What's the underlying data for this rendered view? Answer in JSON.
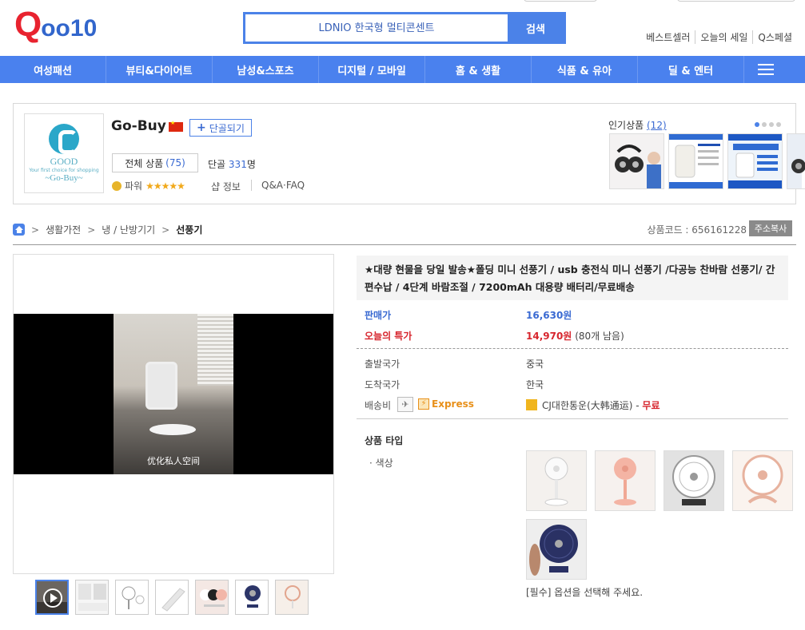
{
  "header": {
    "logo": "Qoo10",
    "search_placeholder": "LDNIO 한국형 멀티콘센트",
    "search_button": "검색",
    "links": [
      "베스트셀러",
      "오늘의 세일",
      "Q스페셜"
    ]
  },
  "nav": {
    "items": [
      "여성패션",
      "뷰티&다이어트",
      "남성&스포츠",
      "디지털 / 모바일",
      "홈 & 생활",
      "식품 & 유아",
      "딜 & 엔터"
    ]
  },
  "seller": {
    "name": "Go-Buy",
    "logo_good": "GOOD",
    "logo_tag": "Your first choice for shopping",
    "logo_name": "~Go-Buy~",
    "follow": "단골되기",
    "all_products_label": "전체 상품",
    "all_products_count": "(75)",
    "regular_label": "단골",
    "regular_count": "331",
    "regular_unit": "명",
    "power_label": "파워",
    "power_stars": "★★★★★",
    "shop_info": "샵 정보",
    "qa": "Q&A·FAQ",
    "popular_label": "인기상품",
    "popular_count": "(12)"
  },
  "breadcrumb": {
    "items": [
      "생활가전",
      "냉 / 난방기기",
      "선풍기"
    ]
  },
  "product": {
    "code_label": "상품코드 : 656161228",
    "copy_button": "주소복사",
    "title": "★대량 현물을 당일 발송★폴딩 미니 선풍기 / usb 충전식 미니 선풍기 /다공능 찬바람 선풍기/ 간편수납 / 4단계 바람조절 / 7200mAh 대용량 배터리/무료배송",
    "video_subtitle": "优化私人空间",
    "price_label": "판매가",
    "price": "16,630원",
    "deal_label": "오늘의 특가",
    "deal_price": "14,970원",
    "deal_remain": "(80개 남음)",
    "origin_label": "출발국가",
    "origin": "중국",
    "dest_label": "도착국가",
    "dest": "한국",
    "shipping_label": "배송비",
    "express": "Express",
    "carrier": "CJ대한통운(大韩通运) -",
    "shipping_fee": "무료",
    "type_label": "상품 타입",
    "color_label": "· 색상",
    "option_note": "[필수] 옵션을 선택해 주세요."
  },
  "colors": {
    "brand_red": "#e8232f",
    "brand_blue": "#4a81ee",
    "price_blue": "#3a6ad2",
    "deal_red": "#d7262e"
  }
}
